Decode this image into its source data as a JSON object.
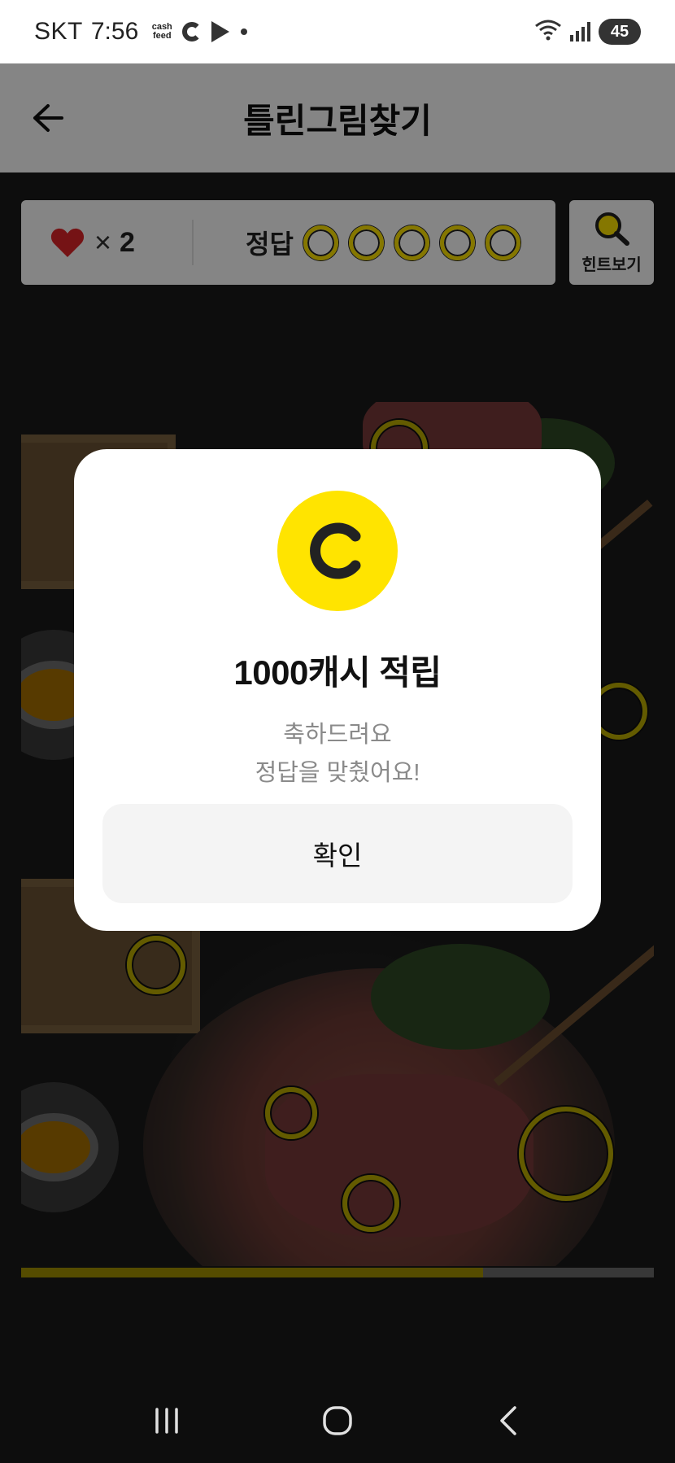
{
  "status_bar": {
    "carrier": "SKT",
    "time": "7:56",
    "cashfeed_icon_text": "cash feed",
    "battery": "45",
    "icons": [
      "cashfeed-icon",
      "c-app-icon",
      "play-store-icon",
      "notification-dot-icon",
      "wifi-icon",
      "signal-icon",
      "battery-icon"
    ]
  },
  "header": {
    "title": "틀린그림찾기",
    "back_icon": "arrow-left-icon"
  },
  "game_status": {
    "lives_icon": "heart-icon",
    "lives_multiplier": "×",
    "lives_count": "2",
    "answers_label": "정답",
    "answers_total": 5,
    "answers_found": 0,
    "hint_label": "힌트보기",
    "hint_icon": "magnifier-icon"
  },
  "progress": {
    "fraction": 0.73
  },
  "dialog": {
    "coin_letter": "C",
    "title": "1000캐시 적립",
    "message_line1": "축하드려요",
    "message_line2": "정답을 맞췄어요!",
    "confirm_label": "확인"
  },
  "colors": {
    "accent_yellow": "#FFE400",
    "heart_red": "#E0262A",
    "background_dark": "#1A1A1A",
    "button_gray": "#F4F4F4",
    "message_gray": "#8A8A8A"
  },
  "nav_bar": {
    "icons": [
      "recents-icon",
      "home-icon",
      "back-icon"
    ]
  }
}
